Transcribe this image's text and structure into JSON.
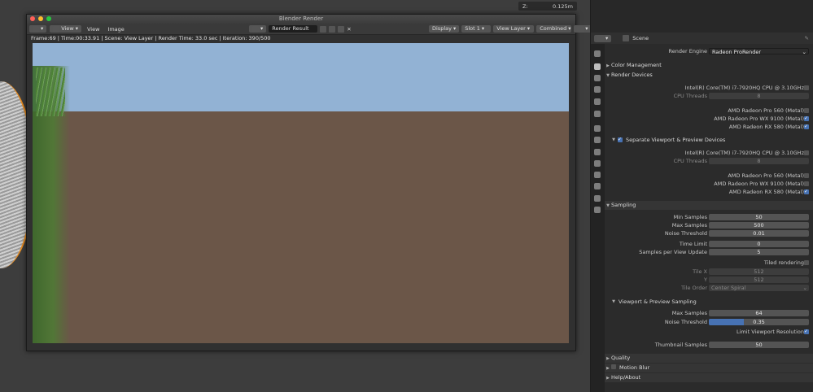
{
  "viewport": {
    "z_label": "Z:",
    "z_value": "0.125m"
  },
  "render_window": {
    "title": "Blender Render",
    "menus": [
      "View",
      "View",
      "Image"
    ],
    "image_name": "Render Result",
    "display_label": "Display",
    "slot_label": "Slot 1",
    "view_layer_label": "View Layer",
    "combined_label": "Combined",
    "status": "Frame:69 | Time:00:33.91 | Scene: View Layer | Render Time: 33.0 sec | Iteration: 390/500"
  },
  "properties": {
    "scene_label": "Scene",
    "render_engine_label": "Render Engine",
    "render_engine_value": "Radeon ProRender",
    "color_management": "Color Management",
    "render_devices": "Render Devices",
    "cpu_name": "Intel(R) Core(TM) i7-7920HQ CPU @ 3.10GHz",
    "cpu_threads_label": "CPU Threads",
    "cpu_threads_value": "8",
    "gpu1": "AMD Radeon Pro 560 (Metal)",
    "gpu2": "AMD Radeon Pro WX 9100 (Metal)",
    "gpu3": "AMD Radeon RX 580 (Metal)",
    "separate_label": "Separate Viewport & Preview Devices",
    "sampling": "Sampling",
    "min_samples_label": "Min Samples",
    "min_samples": "50",
    "max_samples_label": "Max Samples",
    "max_samples": "500",
    "noise_threshold_label": "Noise Threshold",
    "noise_threshold": "0.01",
    "time_limit_label": "Time Limit",
    "time_limit": "0",
    "spvu_label": "Samples per View Update",
    "spvu": "5",
    "tiled_label": "Tiled rendering",
    "tile_x_label": "Tile X",
    "tile_x": "512",
    "tile_y_label": "Y",
    "tile_y": "512",
    "tile_order_label": "Tile Order",
    "tile_order": "Center Spiral",
    "vp_sampling": "Viewport & Preview Sampling",
    "vp_max_samples": "64",
    "vp_noise": "0.35",
    "vp_noise_fill": 0.35,
    "limit_res_label": "Limit Viewport Resolution",
    "thumb_label": "Thumbnail Samples",
    "thumb_value": "50",
    "quality": "Quality",
    "motion_blur": "Motion Blur",
    "help": "Help/About"
  }
}
